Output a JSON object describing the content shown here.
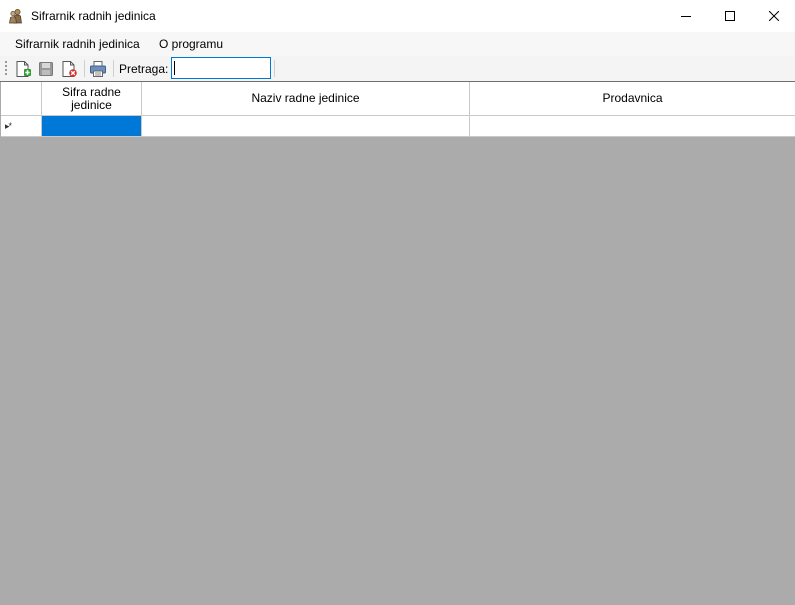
{
  "window": {
    "title": "Sifrarnik radnih jedinica",
    "icon": "people-icon"
  },
  "menu": {
    "items": [
      {
        "label": "Sifrarnik radnih jedinica"
      },
      {
        "label": "O programu"
      }
    ]
  },
  "toolbar": {
    "buttons": [
      {
        "icon": "new-document-icon"
      },
      {
        "icon": "save-icon"
      },
      {
        "icon": "delete-document-icon"
      },
      {
        "icon": "print-icon"
      }
    ],
    "search_label": "Pretraga:",
    "search_value": ""
  },
  "grid": {
    "columns": [
      {
        "label": "Sifra radne jedinice"
      },
      {
        "label": "Naziv radne jedinice"
      },
      {
        "label": "Prodavnica"
      }
    ],
    "new_row_indicator": "▸*",
    "rows": []
  },
  "colors": {
    "selection": "#0078d7",
    "background": "#ababab"
  }
}
